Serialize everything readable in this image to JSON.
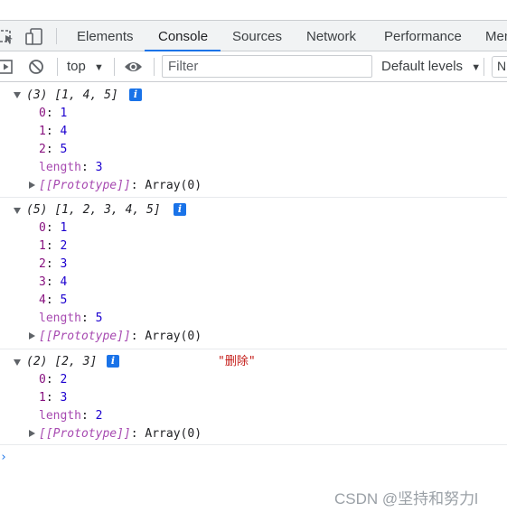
{
  "tabs": {
    "items": [
      "Elements",
      "Console",
      "Sources",
      "Network",
      "Performance",
      "Mem"
    ],
    "active": "Console"
  },
  "toolbar": {
    "context": "top",
    "filter_placeholder": "Filter",
    "levels": "Default levels",
    "issues_label": "N"
  },
  "messages": [
    {
      "summary_count": "(3)",
      "summary_preview": "[1, 4, 5]",
      "entries": [
        {
          "key": "0",
          "value": "1"
        },
        {
          "key": "1",
          "value": "4"
        },
        {
          "key": "2",
          "value": "5"
        }
      ],
      "length_key": "length",
      "length_value": "3",
      "proto_key": "[[Prototype]]",
      "proto_value": "Array(0)"
    },
    {
      "summary_count": "(5)",
      "summary_preview": "[1, 2, 3, 4, 5]",
      "entries": [
        {
          "key": "0",
          "value": "1"
        },
        {
          "key": "1",
          "value": "2"
        },
        {
          "key": "2",
          "value": "3"
        },
        {
          "key": "3",
          "value": "4"
        },
        {
          "key": "4",
          "value": "5"
        }
      ],
      "length_key": "length",
      "length_value": "5",
      "proto_key": "[[Prototype]]",
      "proto_value": "Array(0)"
    },
    {
      "summary_count": "(2)",
      "summary_preview": "[2, 3]",
      "extra_string": "\"删除\"",
      "entries": [
        {
          "key": "0",
          "value": "2"
        },
        {
          "key": "1",
          "value": "3"
        }
      ],
      "length_key": "length",
      "length_value": "2",
      "proto_key": "[[Prototype]]",
      "proto_value": "Array(0)"
    }
  ],
  "info_icon_glyph": "i",
  "watermark": "CSDN @坚持和努力l",
  "colors": {
    "accent": "#1a73e8",
    "key": "#881280",
    "number": "#1c00cf",
    "string": "#c41a16"
  }
}
